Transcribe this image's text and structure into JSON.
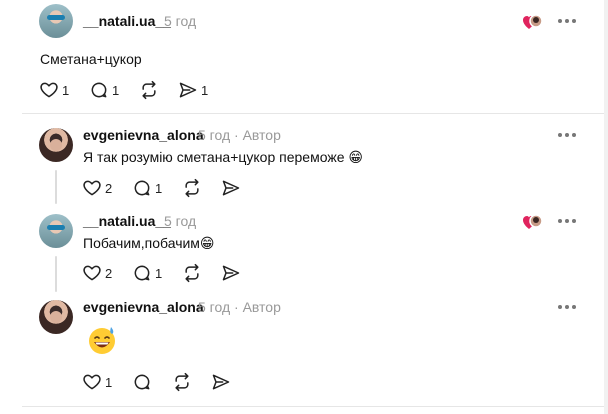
{
  "comments": [
    {
      "username": "__natali.ua__",
      "time": "5 год",
      "author_label": "",
      "text": "Сметана+цукор",
      "likes": "1",
      "replies": "1",
      "reposts": "",
      "shares": "1",
      "liked_by_author": true
    },
    {
      "username": "evgenievna_alona",
      "time": "5 год",
      "author_label": "Автор",
      "text": "Я так розумію сметана+цукор переможе 😁",
      "likes": "2",
      "replies": "1",
      "reposts": "",
      "shares": "",
      "liked_by_author": false
    },
    {
      "username": "__natali.ua__",
      "time": "5 год",
      "author_label": "",
      "text": "Побачим,побачим😁",
      "likes": "2",
      "replies": "1",
      "reposts": "",
      "shares": "",
      "liked_by_author": true
    },
    {
      "username": "evgenievna_alona",
      "time": "5 год",
      "author_label": "Автор",
      "text": "",
      "emoji": "grinning-sweat-emoji",
      "likes": "1",
      "replies": "",
      "reposts": "",
      "shares": "",
      "liked_by_author": false
    }
  ],
  "separator": "·",
  "colors": {
    "heart": "#e0245e",
    "muted": "#999999",
    "divider": "#e6e6e6"
  },
  "icons": [
    "heart-icon",
    "comment-icon",
    "repost-icon",
    "share-icon",
    "more-icon"
  ]
}
